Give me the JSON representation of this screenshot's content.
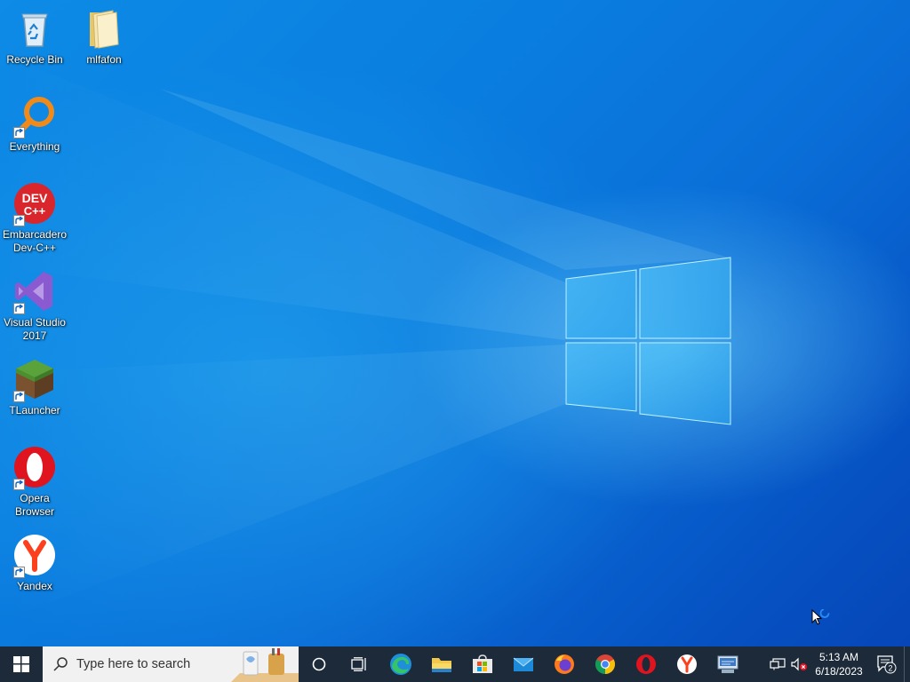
{
  "desktop_icons": [
    {
      "key": "recycle-bin",
      "label": "Recycle Bin",
      "shortcut": false
    },
    {
      "key": "mlfafon",
      "label": "mlfafon",
      "shortcut": false
    },
    {
      "key": "everything",
      "label": "Everything",
      "shortcut": true
    },
    {
      "key": "devcpp",
      "label": "Embarcadero\nDev-C++",
      "shortcut": true
    },
    {
      "key": "visual-studio",
      "label": "Visual Studio\n2017",
      "shortcut": true
    },
    {
      "key": "tlauncher",
      "label": "TLauncher",
      "shortcut": true
    },
    {
      "key": "opera",
      "label": "Opera\nBrowser",
      "shortcut": true
    },
    {
      "key": "yandex",
      "label": "Yandex",
      "shortcut": true
    }
  ],
  "devcpp_logo": {
    "line1": "DEV",
    "line2": "C++"
  },
  "taskbar": {
    "search_placeholder": "Type here to search",
    "pinned": [
      "cortana-icon",
      "task-view-icon",
      "edge-icon",
      "file-explorer-icon",
      "store-icon",
      "mail-icon",
      "firefox-icon",
      "chrome-icon",
      "opera-icon",
      "yandex-icon",
      "network-app-icon"
    ]
  },
  "tray": {
    "time": "5:13 AM",
    "date": "6/18/2023",
    "notification_count": "2",
    "volume_muted": true
  },
  "colors": {
    "taskbar_bg": "#1c2a3a",
    "wallpaper_accent": "#0a7ee0",
    "opera_red": "#e0141e",
    "yandex_red": "#fc3f1d"
  }
}
